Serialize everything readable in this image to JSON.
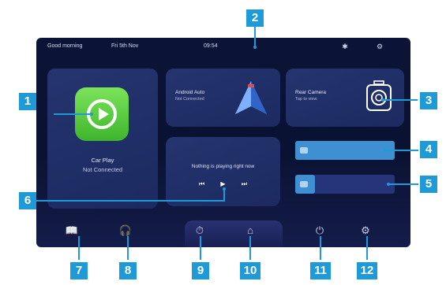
{
  "status_bar": {
    "greeting": "Good morning",
    "date": "Fri 5th Nov",
    "time": "09:54",
    "icons": [
      "bluetooth-icon",
      "settings-icon"
    ]
  },
  "tiles": {
    "carplay": {
      "title": "Car Play",
      "status": "Not Connected",
      "icon": "carplay-icon"
    },
    "android_auto": {
      "title": "Android Auto",
      "subtitle": "Not Connected",
      "icon": "android-auto-icon"
    },
    "rear_camera": {
      "title": "Rear Camera",
      "subtitle": "Tap to view",
      "icon": "camera-icon"
    },
    "music": {
      "title": "Nothing is playing right now",
      "controls": [
        "previous-icon",
        "play-icon",
        "next-icon"
      ]
    }
  },
  "sliders": {
    "volume": {
      "icon": "volume-icon",
      "level": 1.0
    },
    "brightness": {
      "icon": "brightness-icon",
      "level": 0.2
    }
  },
  "dock": {
    "buttons": [
      "book-icon",
      "headphones-icon",
      "timer-icon",
      "home-icon",
      "power-icon",
      "settings-icon"
    ]
  },
  "callouts": [
    "1",
    "2",
    "3",
    "4",
    "5",
    "6",
    "7",
    "8",
    "9",
    "10",
    "11",
    "12"
  ],
  "colors": {
    "callout": "#1e9ad6",
    "screen_bg": "#0b1436",
    "tile_bg": "#23316a",
    "carplay_green": "#5bd043",
    "slider_fill": "#3f8fd3"
  }
}
